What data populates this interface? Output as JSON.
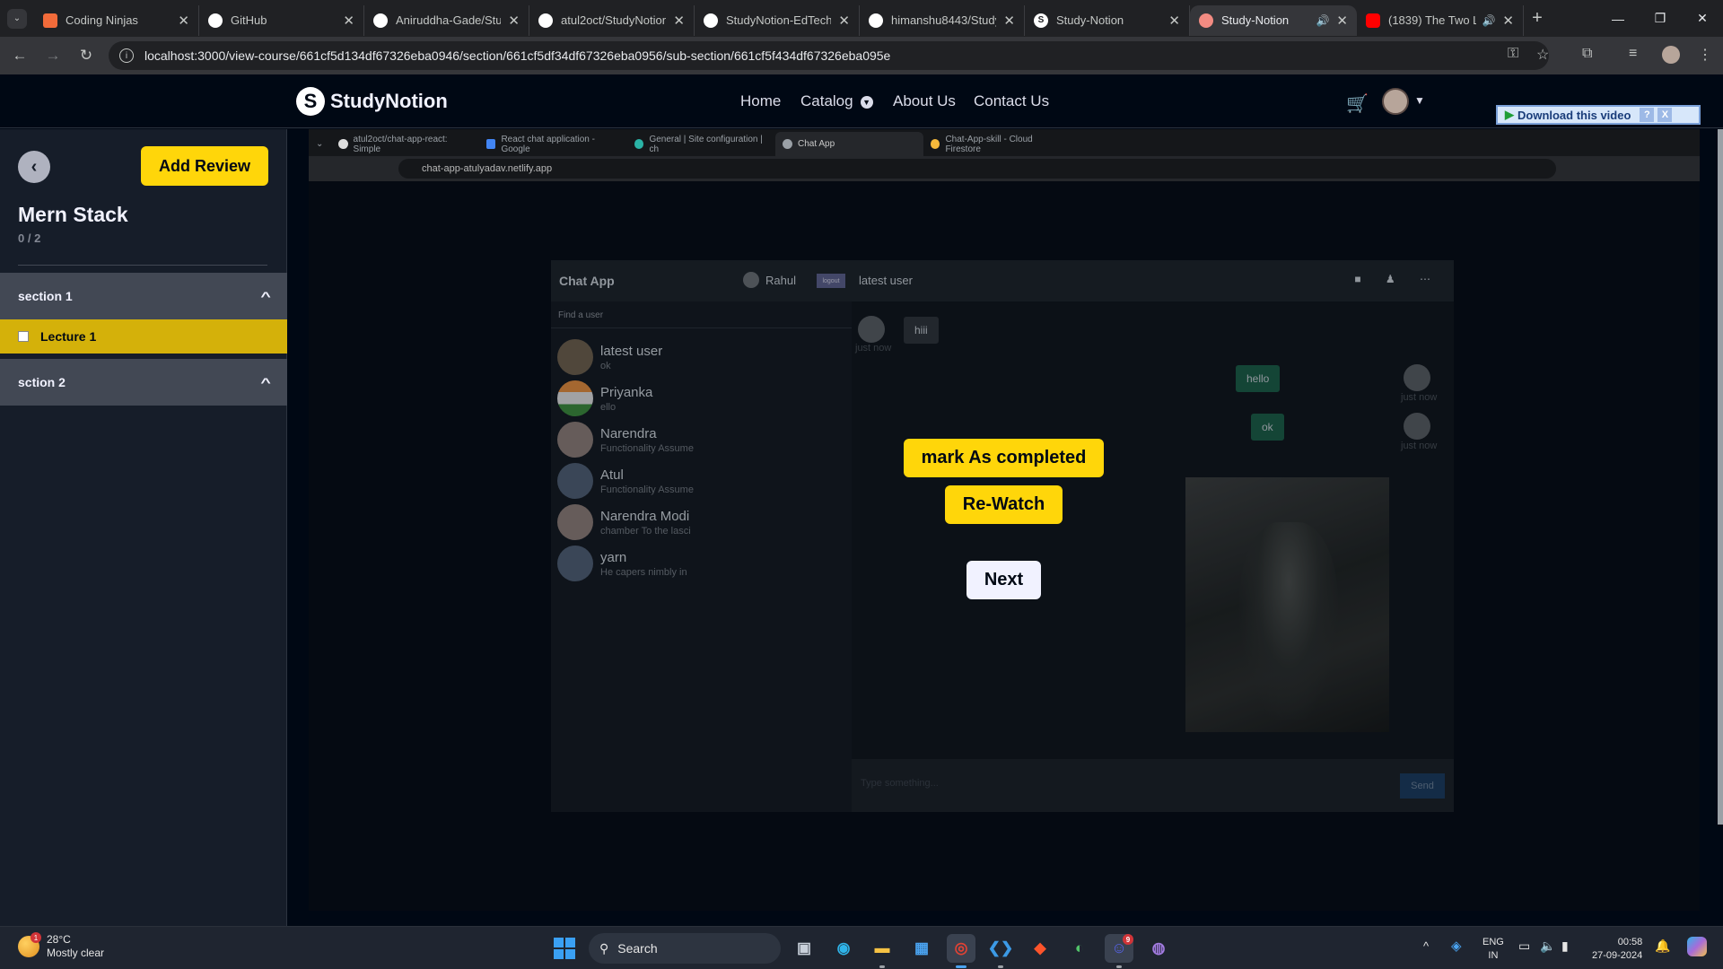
{
  "browser": {
    "tabs": [
      {
        "title": "Coding Ninjas",
        "icon": "coding-ninjas-icon",
        "color": "#f26b3a"
      },
      {
        "title": "GitHub",
        "icon": "github-icon",
        "color": "#ffffff"
      },
      {
        "title": "Aniruddha-Gade/Stu",
        "icon": "github-icon",
        "color": "#ffffff"
      },
      {
        "title": "atul2oct/StudyNotion",
        "icon": "github-icon",
        "color": "#ffffff"
      },
      {
        "title": "StudyNotion-EdTech-",
        "icon": "github-icon",
        "color": "#ffffff"
      },
      {
        "title": "himanshu8443/Study",
        "icon": "github-icon",
        "color": "#ffffff"
      },
      {
        "title": "Study-Notion",
        "icon": "studynotion-icon",
        "color": "#ffffff"
      },
      {
        "title": "Study-Notion",
        "icon": "studynotion-icon",
        "color": "#f28b82",
        "active": true
      },
      {
        "title": "(1839) The Two Li",
        "icon": "youtube-icon",
        "color": "#ff0000"
      }
    ],
    "url": "localhost:3000/view-course/661cf5d134df67326eba0946/section/661cf5df34df67326eba0956/sub-section/661cf5f434df67326eba095e"
  },
  "navbar": {
    "logo_mark": "S",
    "logo_text": "StudyNotion",
    "links": [
      "Home",
      "Catalog",
      "About Us",
      "Contact Us"
    ],
    "download_video": "Download this video",
    "download_help": "?",
    "download_close": "X"
  },
  "sidebar": {
    "add_review": "Add Review",
    "course_title": "Mern Stack",
    "progress": "0 / 2",
    "sections": [
      {
        "name": "section 1",
        "lectures": [
          "Lecture 1"
        ]
      },
      {
        "name": "sction 2",
        "lectures": []
      }
    ]
  },
  "video": {
    "tabs": [
      "atul2oct/chat-app-react: Simple",
      "React chat application - Google",
      "General | Site configuration | ch",
      "Chat App",
      "Chat-App-skill - Cloud Firestore"
    ],
    "url": "chat-app-atulyadav.netlify.app",
    "chat": {
      "app_title": "Chat App",
      "current_user": "Rahul",
      "logout": "logout",
      "peer": "latest user",
      "find_placeholder": "Find a user",
      "users": [
        {
          "name": "latest user",
          "last": "ok"
        },
        {
          "name": "Priyanka",
          "last": "ello"
        },
        {
          "name": "Narendra",
          "last": "Functionality Assume"
        },
        {
          "name": "Atul",
          "last": "Functionality Assume"
        },
        {
          "name": "Narendra Modi",
          "last": "chamber To the lasci"
        },
        {
          "name": "yarn",
          "last": "He capers nimbly in"
        }
      ],
      "messages": [
        {
          "text": "hiii",
          "time": "just now",
          "side": "left"
        },
        {
          "text": "hello",
          "time": "just now",
          "side": "right"
        },
        {
          "text": "ok",
          "time": "just now",
          "side": "right"
        }
      ],
      "input_placeholder": "Type something...",
      "send": "Send"
    }
  },
  "overlay": {
    "mark_completed": "mark As completed",
    "rewatch": "Re-Watch",
    "next": "Next"
  },
  "taskbar": {
    "weather_temp": "28°C",
    "weather_desc": "Mostly clear",
    "weather_badge": "1",
    "search": "Search",
    "lang_1": "ENG",
    "lang_2": "IN",
    "time": "00:58",
    "date": "27-09-2024",
    "discord_badge": "9"
  },
  "colors": {
    "accent_yellow": "#ffd60a",
    "sidebar_bg": "#161d29",
    "page_bg": "#000814",
    "section_bg": "#424854"
  }
}
